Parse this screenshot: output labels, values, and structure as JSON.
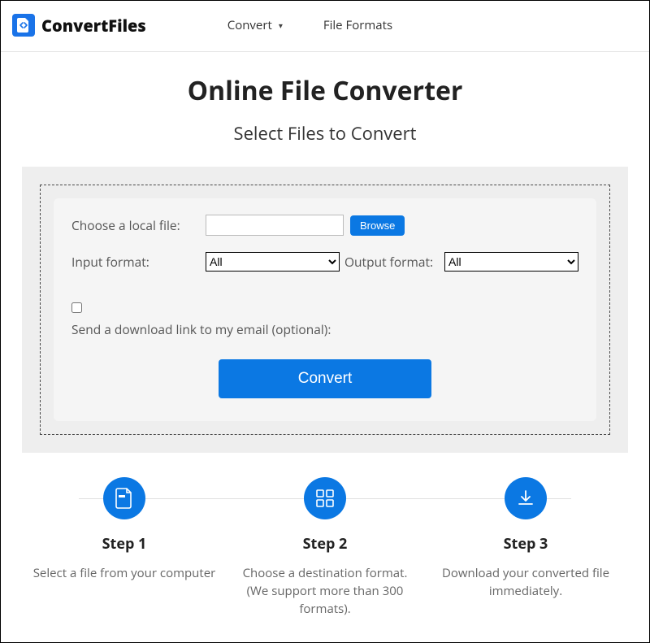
{
  "header": {
    "brand": "ConvertFiles",
    "nav": {
      "convert": "Convert",
      "formats": "File Formats"
    }
  },
  "page": {
    "title": "Online File Converter",
    "subtitle": "Select Files to Convert"
  },
  "form": {
    "choose_label": "Choose a local file:",
    "browse": "Browse",
    "input_format_label": "Input format:",
    "output_format_label": "Output format:",
    "input_select_value": "All",
    "output_select_value": "All",
    "email_opt": "Send a download link to my email (optional):",
    "convert": "Convert"
  },
  "steps": [
    {
      "title": "Step 1",
      "desc": "Select a file from your computer"
    },
    {
      "title": "Step 2",
      "desc": "Choose a destination format. (We support more than 300 formats)."
    },
    {
      "title": "Step 3",
      "desc": "Download your converted file immediately."
    }
  ]
}
